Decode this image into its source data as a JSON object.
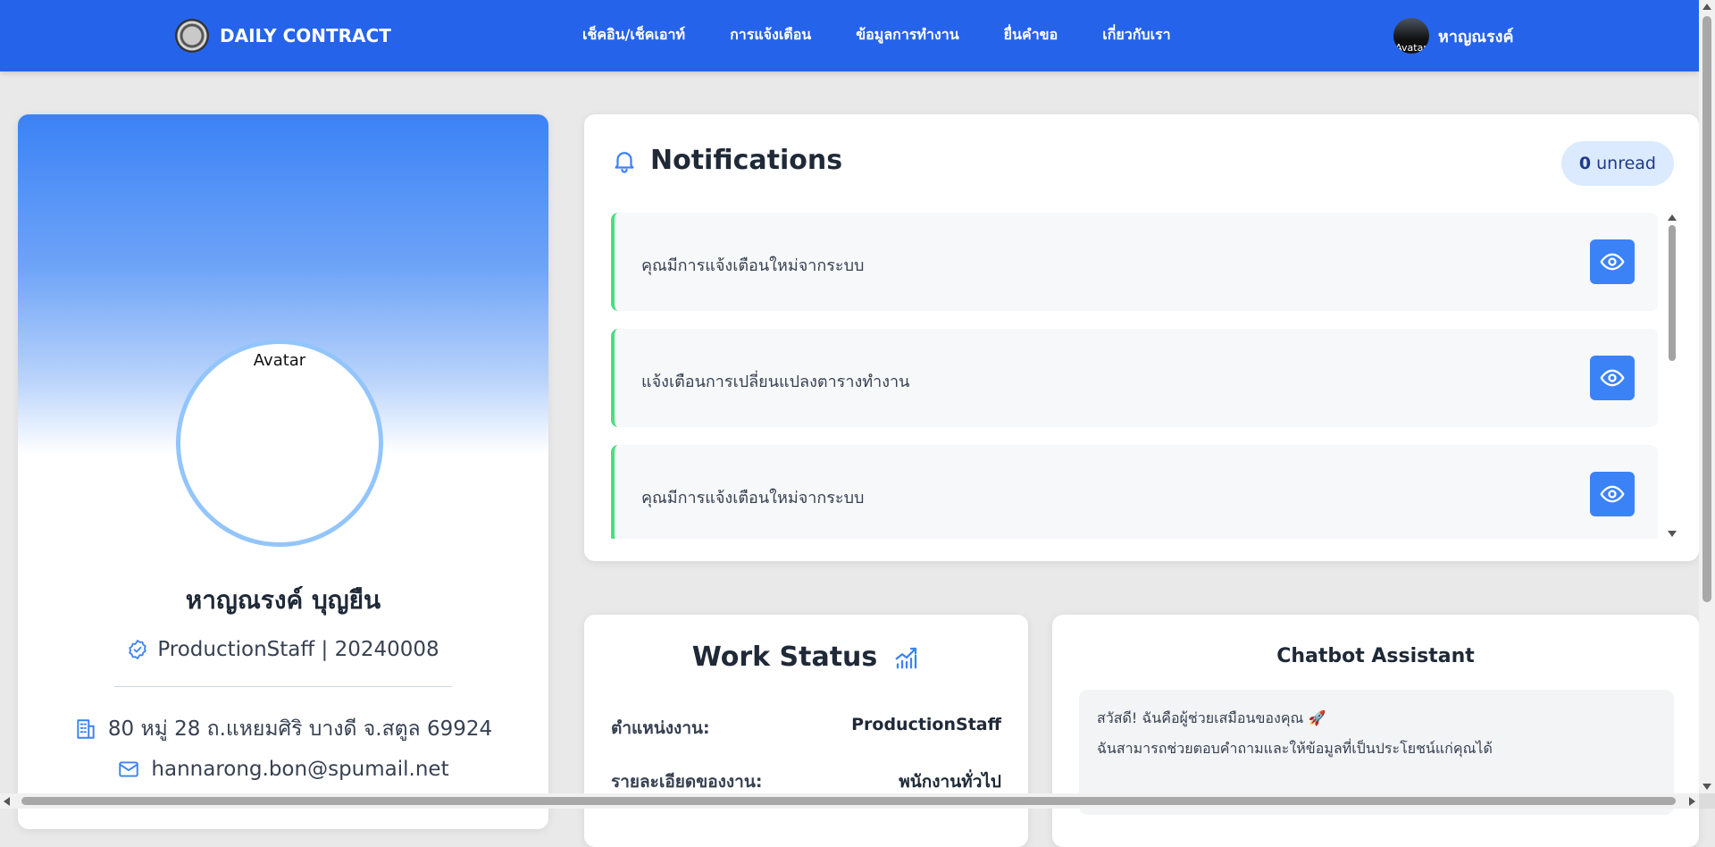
{
  "navbar": {
    "brand_name": "DAILY CONTRACT",
    "brand_logo_text": "DAILY CONTRACT",
    "links": [
      {
        "label": "เช็คอิน/เช็คเอาท์"
      },
      {
        "label": "การแจ้งเตือน"
      },
      {
        "label": "ข้อมูลการทำงาน"
      },
      {
        "label": "ยื่นคำขอ"
      },
      {
        "label": "เกี่ยวกับเรา"
      }
    ],
    "user_avatar_alt": "Avatar",
    "user_name": "หาญณรงค์"
  },
  "profile": {
    "avatar_alt": "Avatar",
    "name": "หาญณรงค์ บุญยืน",
    "role_line": "ProductionStaff | 20240008",
    "address": "80 หมู่ 28 ถ.แหยมศิริ บางดี จ.สตูล 69924",
    "email": "hannarong.bon@spumail.net"
  },
  "notifications": {
    "title": "Notifications",
    "unread_count": "0",
    "unread_label": "unread",
    "items": [
      {
        "text": "คุณมีการแจ้งเตือนใหม่จากระบบ"
      },
      {
        "text": "แจ้งเตือนการเปลี่ยนแปลงตารางทำงาน"
      },
      {
        "text": "คุณมีการแจ้งเตือนใหม่จากระบบ"
      }
    ]
  },
  "work_status": {
    "title": "Work Status",
    "rows": [
      {
        "label": "ตำแหน่งงาน:",
        "value": "ProductionStaff"
      },
      {
        "label": "รายละเอียดของงาน:",
        "value": "พนักงานทั่วไป"
      }
    ]
  },
  "chatbot": {
    "title": "Chatbot Assistant",
    "message_line1": "สวัสดี! ฉันคือผู้ช่วยเสมือนของคุณ 🚀",
    "message_line2": "ฉันสามารถช่วยตอบคำถามและให้ข้อมูลที่เป็นประโยชน์แก่คุณได้"
  },
  "colors": {
    "nav_bg": "#2563eb",
    "accent": "#3b82f6",
    "notif_border": "#4ade80",
    "avatar_ring": "#93c5fd"
  },
  "icons": {
    "bell": "bell-icon",
    "eye": "eye-icon",
    "verified": "verified-badge-icon",
    "building": "building-icon",
    "mail": "mail-icon",
    "chart": "chart-icon"
  }
}
